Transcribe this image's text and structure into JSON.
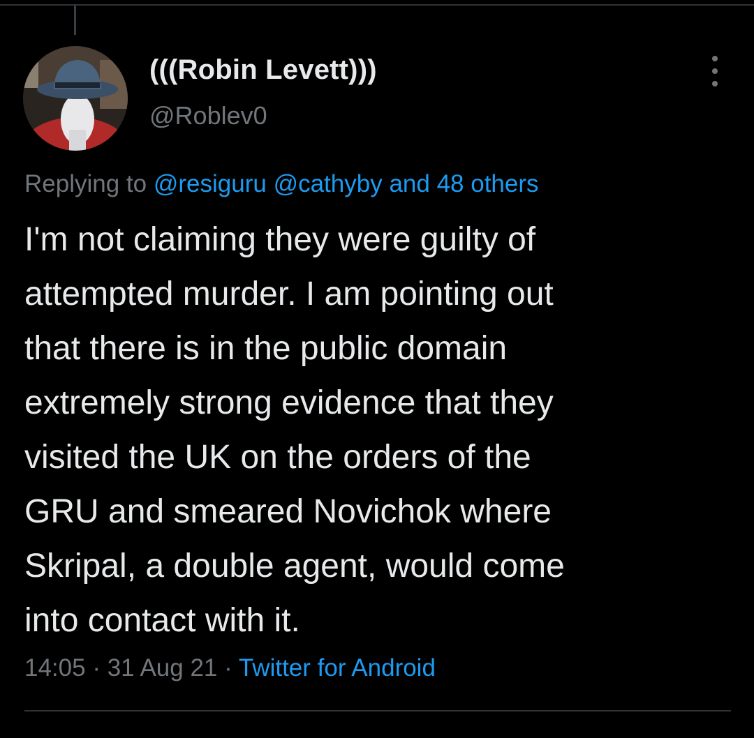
{
  "tweet": {
    "display_name": "(((Robin Levett)))",
    "handle": "@Roblev0",
    "replying": {
      "prefix": "Replying to",
      "mention_1": "@resiguru",
      "mention_2": "@cathyby",
      "others": "and 48 others"
    },
    "body_lines": [
      "I'm not claiming they were guilty of",
      "attempted murder. I am pointing out",
      "that there is in the public domain",
      "extremely strong evidence that they",
      "visited the UK on the orders of the",
      "GRU and smeared Novichok where",
      "Skripal, a double agent, would come",
      "into contact with it."
    ],
    "time": "14:05",
    "date": "31 Aug 21",
    "source": "Twitter for Android",
    "separator": "·"
  },
  "icons": {
    "more": "more-vertical-icon",
    "avatar": "avatar-hat-figure"
  },
  "colors": {
    "background": "#000000",
    "text_primary": "#e7e9ea",
    "text_secondary": "#71767b",
    "link": "#1d9bf0",
    "divider": "#2f3336"
  }
}
